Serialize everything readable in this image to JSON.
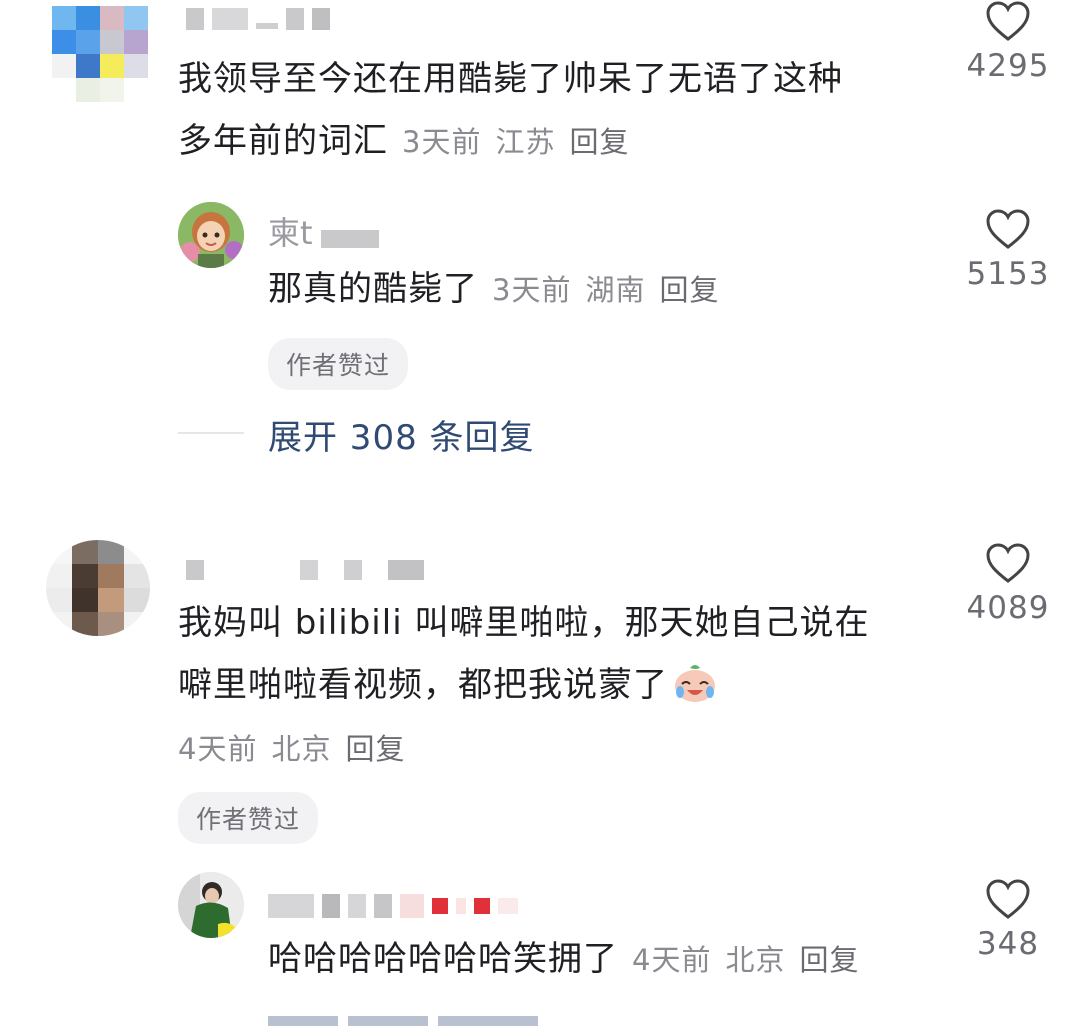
{
  "comments": [
    {
      "text_line1": "我领导至今还在用酷毙了帅呆了无语了这种",
      "text_line2": "多年前的词汇",
      "time": "3天前",
      "location": "江苏",
      "reply_label": "回复",
      "likes": "4295",
      "reply": {
        "username_partial": "柬t",
        "text": "那真的酷毙了",
        "time": "3天前",
        "location": "湖南",
        "reply_label": "回复",
        "likes": "5153",
        "author_liked": "作者赞过"
      },
      "expand_label": "展开 308 条回复"
    },
    {
      "text_line1": "我妈叫 bilibili 叫噼里啪啦，那天她自己说在",
      "text_line2": "噼里啪啦看视频，都把我说蒙了",
      "time": "4天前",
      "location": "北京",
      "reply_label": "回复",
      "likes": "4089",
      "author_liked": "作者赞过",
      "reply": {
        "text": "哈哈哈哈哈哈哈笑拥了",
        "time": "4天前",
        "location": "北京",
        "reply_label": "回复",
        "likes": "348"
      }
    }
  ],
  "colors": {
    "text": "#1f1f24",
    "meta": "#8a8a90",
    "expand": "#304a74",
    "heart": "#444448"
  }
}
